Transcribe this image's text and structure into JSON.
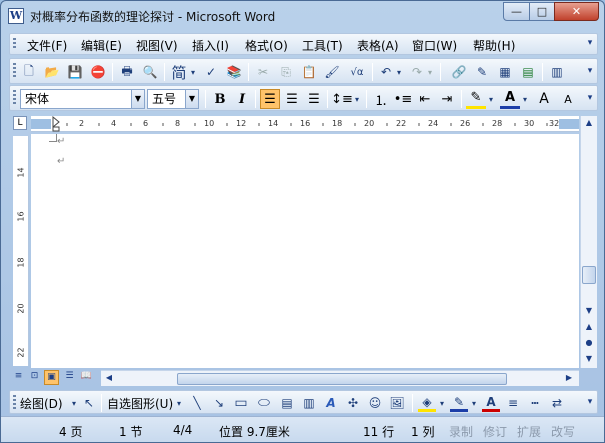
{
  "window": {
    "title": "对概率分布函数的理论探讨 - Microsoft Word",
    "app_icon_letter": "W",
    "minimize_glyph": "—",
    "maximize_glyph": "□",
    "close_glyph": "✕"
  },
  "menu": {
    "items": [
      "文件(F)",
      "编辑(E)",
      "视图(V)",
      "插入(I)",
      "格式(O)",
      "工具(T)",
      "表格(A)",
      "窗口(W)",
      "帮助(H)"
    ]
  },
  "standard_toolbar": {
    "icons": [
      {
        "name": "new-document-icon",
        "glyph": "🗋"
      },
      {
        "name": "open-icon",
        "glyph": "📂"
      },
      {
        "name": "save-icon",
        "glyph": "💾"
      },
      {
        "name": "permission-icon",
        "glyph": "⛔"
      },
      {
        "name": "print-icon",
        "glyph": "🖶"
      },
      {
        "name": "print-preview-icon",
        "glyph": "🔍"
      },
      {
        "name": "simplified-chinese-icon",
        "glyph": "简"
      },
      {
        "name": "spelling-icon",
        "glyph": "✓"
      },
      {
        "name": "research-icon",
        "glyph": "📚"
      },
      {
        "name": "cut-icon",
        "glyph": "✂"
      },
      {
        "name": "copy-icon",
        "glyph": "⎘"
      },
      {
        "name": "paste-icon",
        "glyph": "📋"
      },
      {
        "name": "format-painter-icon",
        "glyph": "🖌"
      },
      {
        "name": "equation-icon",
        "glyph": "√α"
      },
      {
        "name": "undo-icon",
        "glyph": "↶"
      },
      {
        "name": "redo-icon",
        "glyph": "↷"
      },
      {
        "name": "hyperlink-icon",
        "glyph": "🔗"
      },
      {
        "name": "tables-borders-icon",
        "glyph": "✎"
      },
      {
        "name": "insert-table-icon",
        "glyph": "▦"
      },
      {
        "name": "insert-excel-icon",
        "glyph": "▤"
      },
      {
        "name": "columns-icon",
        "glyph": "▥"
      }
    ]
  },
  "format_toolbar": {
    "font_name": "宋体",
    "font_size": "五号",
    "bold": "B",
    "italic": "I",
    "underline_color_label": "A",
    "grow_font": "A",
    "shrink_font": "A"
  },
  "ruler": {
    "corner_glyph": "L",
    "h_ticks": [
      "2",
      "4",
      "6",
      "8",
      "10",
      "12",
      "14",
      "16",
      "18",
      "20",
      "22",
      "24",
      "26",
      "28",
      "30",
      "32"
    ],
    "v_ticks": [
      "14",
      "16",
      "18",
      "20",
      "22"
    ]
  },
  "document": {
    "para_marks": [
      "↵",
      "↵"
    ]
  },
  "view_buttons": [
    {
      "name": "normal-view-icon",
      "glyph": "≡"
    },
    {
      "name": "web-view-icon",
      "glyph": "⊡"
    },
    {
      "name": "print-layout-icon",
      "glyph": "▣"
    },
    {
      "name": "outline-view-icon",
      "glyph": "☰"
    },
    {
      "name": "reading-view-icon",
      "glyph": "📖"
    }
  ],
  "drawing_toolbar": {
    "draw_label": "绘图(D)",
    "autoshapes_label": "自选图形(U)"
  },
  "status": {
    "page": "4 页",
    "section": "1 节",
    "page_of": "4/4",
    "position": "位置 9.7厘米",
    "line": "11 行",
    "column": "1 列",
    "rec": "录制",
    "trk": "修订",
    "ext": "扩展",
    "ovr": "改写"
  }
}
